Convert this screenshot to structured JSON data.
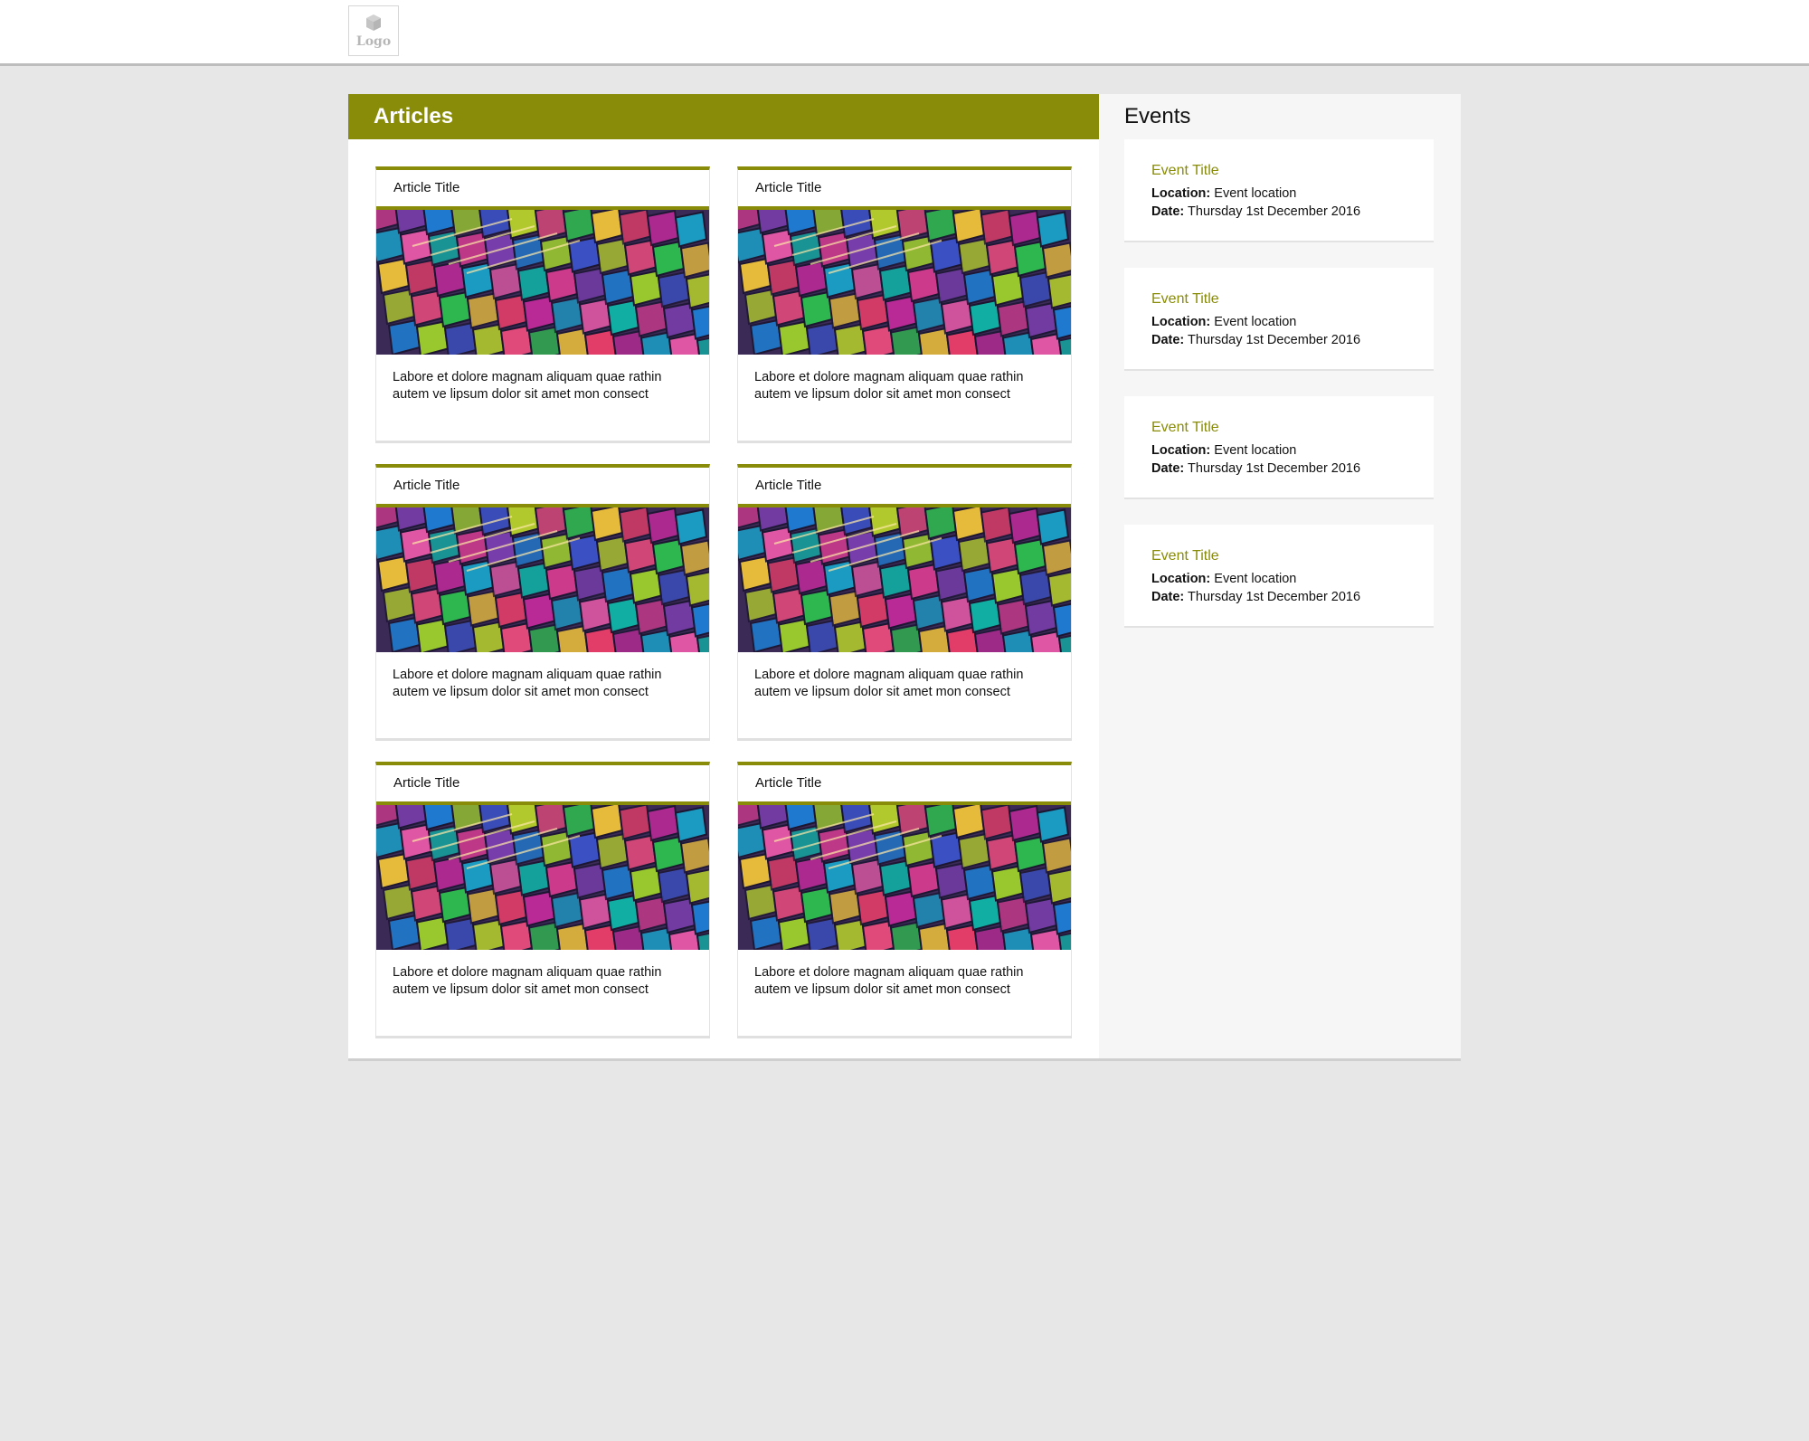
{
  "header": {
    "logo_label": "Logo"
  },
  "articles": {
    "heading": "Articles",
    "items": [
      {
        "title": "Article Title",
        "excerpt_line1": "Labore et dolore magnam aliquam quae rathin",
        "excerpt_line2": "autem ve lipsum dolor sit amet mon consect"
      },
      {
        "title": "Article Title",
        "excerpt_line1": "Labore et dolore magnam aliquam quae rathin",
        "excerpt_line2": "autem ve lipsum dolor sit amet mon consect"
      },
      {
        "title": "Article Title",
        "excerpt_line1": "Labore et dolore magnam aliquam quae rathin",
        "excerpt_line2": "autem ve lipsum dolor sit amet mon consect"
      },
      {
        "title": "Article Title",
        "excerpt_line1": "Labore et dolore magnam aliquam quae rathin",
        "excerpt_line2": "autem ve lipsum dolor sit amet mon consect"
      },
      {
        "title": "Article Title",
        "excerpt_line1": "Labore et dolore magnam aliquam quae rathin",
        "excerpt_line2": "autem ve lipsum dolor sit amet mon consect"
      },
      {
        "title": "Article Title",
        "excerpt_line1": "Labore et dolore magnam aliquam quae rathin",
        "excerpt_line2": "autem ve lipsum dolor sit amet mon consect"
      }
    ]
  },
  "events": {
    "heading": "Events",
    "location_label": "Location:",
    "date_label": "Date:",
    "items": [
      {
        "title": "Event Title",
        "location": "Event location",
        "date": "Thursday 1st December 2016"
      },
      {
        "title": "Event Title",
        "location": "Event location",
        "date": "Thursday 1st December 2016"
      },
      {
        "title": "Event Title",
        "location": "Event location",
        "date": "Thursday 1st December 2016"
      },
      {
        "title": "Event Title",
        "location": "Event location",
        "date": "Thursday 1st December 2016"
      }
    ]
  },
  "colors": {
    "accent": "#888c08",
    "page_background": "#e7e7e7",
    "sidebar_background": "#f6f6f6"
  },
  "icons": {
    "logo": "cube-icon",
    "article_image": "colorful-glass-facade-image"
  }
}
